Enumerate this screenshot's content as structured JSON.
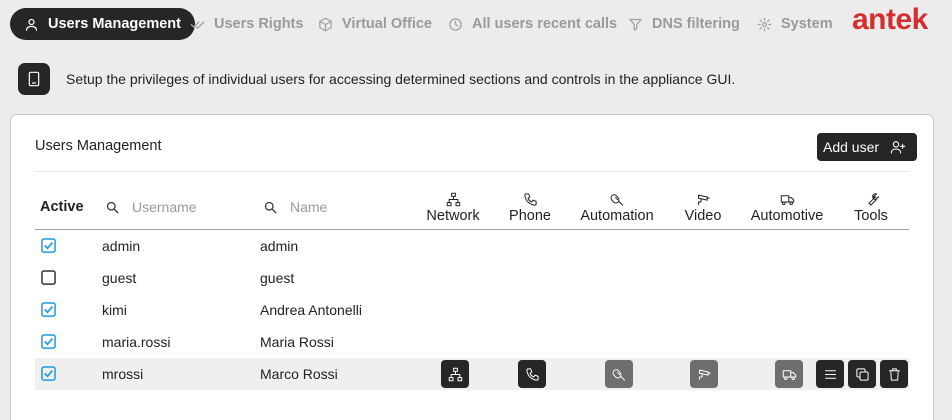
{
  "tabs": [
    {
      "label": "Users Management",
      "icon": "user-icon",
      "active": true
    },
    {
      "label": "Users Rights",
      "icon": "checks-icon",
      "active": false
    },
    {
      "label": "Virtual Office",
      "icon": "cube-icon",
      "active": false
    },
    {
      "label": "All users recent calls",
      "icon": "clock-icon",
      "active": false
    },
    {
      "label": "DNS filtering",
      "icon": "filter-icon",
      "active": false
    },
    {
      "label": "System",
      "icon": "gear-icon",
      "active": false
    }
  ],
  "logo": "antek",
  "info": {
    "text": "Setup the privileges of individual users for accessing determined sections and controls in the appliance GUI."
  },
  "card": {
    "title": "Users Management",
    "add_user_label": "Add user"
  },
  "table": {
    "active_header": "Active",
    "username_placeholder": "Username",
    "name_placeholder": "Name",
    "columns": [
      "Network",
      "Phone",
      "Automation",
      "Video",
      "Automotive",
      "Tools"
    ],
    "rows": [
      {
        "active": true,
        "username": "admin",
        "name": "admin"
      },
      {
        "active": false,
        "username": "guest",
        "name": "guest"
      },
      {
        "active": true,
        "username": "kimi",
        "name": "Andrea Antonelli"
      },
      {
        "active": true,
        "username": "maria.rossi",
        "name": "Maria Rossi"
      },
      {
        "active": true,
        "username": "mrossi",
        "name": "Marco Rossi"
      }
    ]
  },
  "colors": {
    "accent": "#1e9bd7",
    "brand": "#d32f2f",
    "dark": "#262626"
  }
}
